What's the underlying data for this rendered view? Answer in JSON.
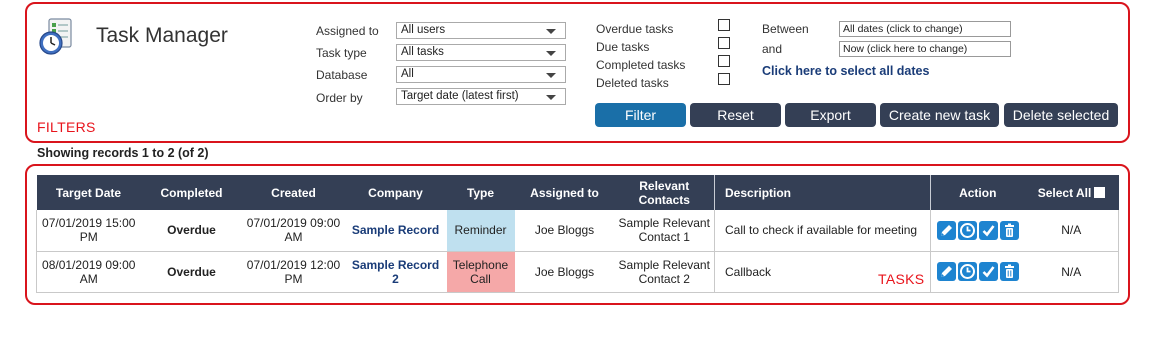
{
  "app": {
    "title": "Task Manager"
  },
  "annotations": {
    "filters_label": "FILTERS",
    "tasks_label": "TASKS"
  },
  "filters": {
    "assigned_to": {
      "label": "Assigned to",
      "value": "All users"
    },
    "task_type": {
      "label": "Task type",
      "value": "All tasks"
    },
    "database": {
      "label": "Database",
      "value": "All"
    },
    "order_by": {
      "label": "Order by",
      "value": "Target date (latest first)"
    }
  },
  "checkboxes": {
    "overdue": {
      "label": "Overdue tasks",
      "checked": false
    },
    "due": {
      "label": "Due tasks",
      "checked": false
    },
    "completed": {
      "label": "Completed tasks",
      "checked": false
    },
    "deleted": {
      "label": "Deleted tasks",
      "checked": false
    }
  },
  "dates": {
    "between_label": "Between",
    "between_value": "All dates (click to change)",
    "and_label": "and",
    "and_value": "Now (click here to change)",
    "select_all_link": "Click here to select all dates"
  },
  "buttons": {
    "filter": "Filter",
    "reset": "Reset",
    "export": "Export",
    "create": "Create new task",
    "delete": "Delete selected"
  },
  "records_text": "Showing records 1 to 2 (of 2)",
  "table": {
    "headers": {
      "target_date": "Target Date",
      "completed": "Completed",
      "created": "Created",
      "company": "Company",
      "type": "Type",
      "assigned_to": "Assigned to",
      "relevant_contacts": "Relevant Contacts",
      "description": "Description",
      "action": "Action",
      "select_all": "Select All"
    },
    "rows": [
      {
        "target_date": "07/01/2019 15:00 PM",
        "completed": "Overdue",
        "created": "07/01/2019 09:00 AM",
        "company": "Sample Record",
        "type": "Reminder",
        "assigned_to": "Joe Bloggs",
        "relevant_contacts": "Sample Relevant Contact 1",
        "description": "Call to check if available for meeting",
        "select": "N/A"
      },
      {
        "target_date": "08/01/2019 09:00 AM",
        "completed": "Overdue",
        "created": "07/01/2019 12:00 PM",
        "company": "Sample Record 2",
        "type": "Telephone Call",
        "assigned_to": "Joe Bloggs",
        "relevant_contacts": "Sample Relevant Contact 2",
        "description": "Callback",
        "select": "N/A"
      }
    ]
  },
  "colors": {
    "header_bg": "#343f55",
    "primary_button": "#1a6fa8",
    "overdue": "#d9141c",
    "reminder_bg": "#bfe0ef",
    "call_bg": "#f5a8a8",
    "link": "#1a3c78",
    "action_icon": "#1e84d0"
  },
  "icons": [
    "task-manager-icon",
    "edit-icon",
    "clock-icon",
    "checkmark-icon",
    "trash-icon"
  ]
}
